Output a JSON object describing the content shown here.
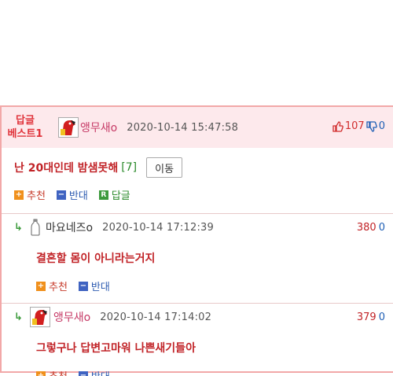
{
  "best_post": {
    "badge_line1": "답글",
    "badge_line2": "베스트1",
    "author": "앵무새o",
    "timestamp": "2020-10-14 15:47:58",
    "upvotes": "107",
    "downvotes": "0",
    "title": "난 20대인데 밤샘못해",
    "comment_count": "[7]",
    "move_label": "이동",
    "actions": {
      "recommend": "추천",
      "oppose": "반대",
      "reply": "답글",
      "reply_icon": "R"
    }
  },
  "comments": [
    {
      "author": "마요네즈o",
      "timestamp": "2020-10-14 17:12:39",
      "upvotes": "380",
      "downvotes": "0",
      "body": "결혼할 몸이 아니라는거지",
      "actions": {
        "recommend": "추천",
        "oppose": "반대"
      }
    },
    {
      "author": "앵무새o",
      "timestamp": "2020-10-14 17:14:02",
      "upvotes": "379",
      "downvotes": "0",
      "body": "그렇구나 답변고마워 나쁜새기들아",
      "actions": {
        "recommend": "추천",
        "oppose": "반대"
      }
    }
  ],
  "colors": {
    "accent_red": "#c12327",
    "header_bg": "#fde9ec",
    "border": "#f2a8a8"
  },
  "icons": {
    "reply_arrow": "reply-arrow-icon",
    "thumb_up": "thumbs-up-icon",
    "thumb_down": "thumbs-down-icon"
  }
}
